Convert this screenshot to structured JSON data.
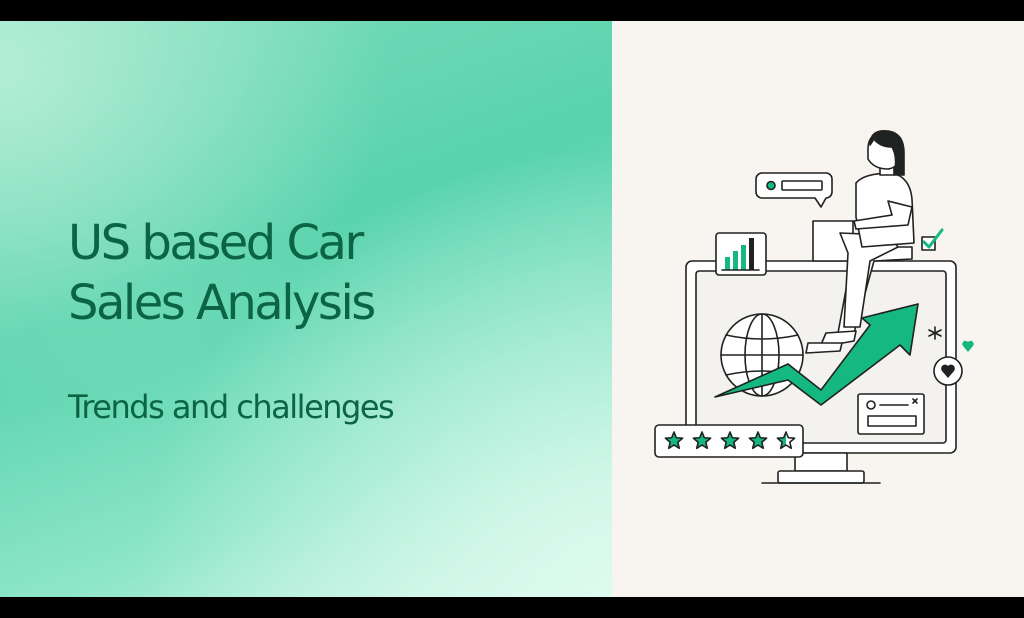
{
  "slide": {
    "title_line1": "US based Car",
    "title_line2": "Sales Analysis",
    "subtitle": "Trends and challenges"
  },
  "illustration": {
    "rating_stars": 4.5,
    "rating_max": 5,
    "icons": [
      "person-on-monitor",
      "globe-icon",
      "trend-up-arrow",
      "bar-chart-icon",
      "chat-bubble-icon",
      "checkbox-icon",
      "heart-icon",
      "asterisk-icon",
      "star-icon"
    ]
  },
  "colors": {
    "brand_green": "#16b882",
    "title_color": "#0b6446",
    "left_bg": "#5fd4ae",
    "right_bg": "#f8f4ef",
    "outline": "#1f2220"
  }
}
